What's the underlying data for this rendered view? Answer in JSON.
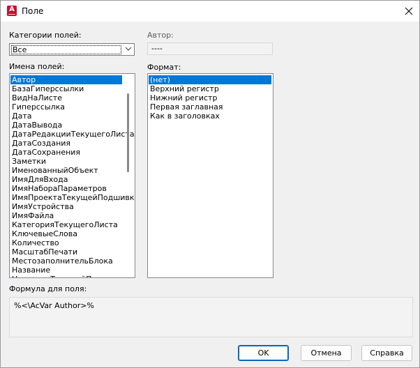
{
  "window": {
    "title": "Поле"
  },
  "categories": {
    "label": "Категории полей:",
    "selected": "Все"
  },
  "author": {
    "label": "Автор:",
    "value": "----"
  },
  "field_names": {
    "label": "Имена полей:",
    "items": [
      {
        "label": "Автор",
        "selected": true
      },
      {
        "label": "БазаГиперссылки"
      },
      {
        "label": "ВидНаЛисте"
      },
      {
        "label": "Гиперссылка"
      },
      {
        "label": "Дата"
      },
      {
        "label": "ДатаВывода"
      },
      {
        "label": "ДатаРедакцииТекущегоЛиста"
      },
      {
        "label": "ДатаСоздания"
      },
      {
        "label": "ДатаСохранения"
      },
      {
        "label": "Заметки"
      },
      {
        "label": "ИменованныйОбъект"
      },
      {
        "label": "ИмяДляВхода"
      },
      {
        "label": "ИмяНабораПараметров"
      },
      {
        "label": "ИмяПроектаТекущейПодшивки"
      },
      {
        "label": "ИмяУстройства"
      },
      {
        "label": "ИмяФайла"
      },
      {
        "label": "КатегорияТекущегоЛиста"
      },
      {
        "label": "КлючевыеСлова"
      },
      {
        "label": "Количество"
      },
      {
        "label": "МасштабПечати"
      },
      {
        "label": "МестозаполнительБлока"
      },
      {
        "label": "Название"
      },
      {
        "label": "НазваниеТекущейПодшивки"
      }
    ]
  },
  "format": {
    "label": "Формат:",
    "items": [
      {
        "label": "(нет)",
        "selected": true
      },
      {
        "label": "Верхний регистр"
      },
      {
        "label": "Нижний регистр"
      },
      {
        "label": "Первая заглавная"
      },
      {
        "label": "Как в заголовках"
      }
    ]
  },
  "formula": {
    "label": "Формула для поля:",
    "value": "%<\\AcVar Author>%"
  },
  "buttons": {
    "ok": "OK",
    "cancel": "Отмена",
    "help": "Справка"
  },
  "colors": {
    "selection": "#0078d7",
    "accent": "#c8102e"
  }
}
